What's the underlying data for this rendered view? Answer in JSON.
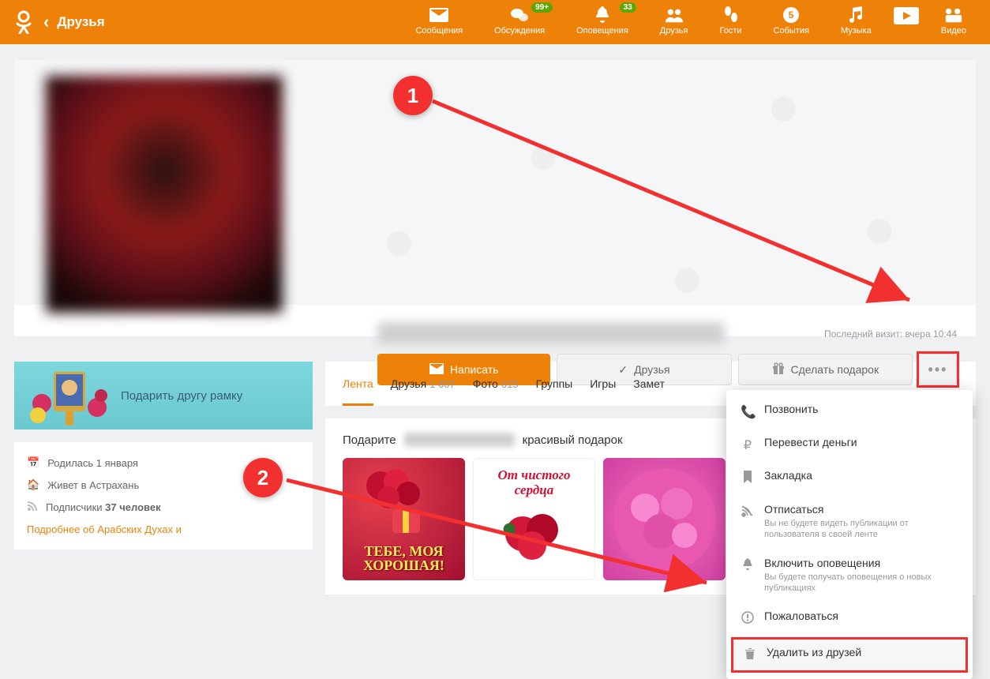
{
  "header": {
    "page_title": "Друзья",
    "nav": [
      {
        "label": "Сообщения"
      },
      {
        "label": "Обсуждения",
        "badge": "99+"
      },
      {
        "label": "Оповещения",
        "badge": "33"
      },
      {
        "label": "Друзья"
      },
      {
        "label": "Гости"
      },
      {
        "label": "События",
        "badge": "5"
      },
      {
        "label": "Музыка"
      },
      {
        "label": "Видео"
      }
    ]
  },
  "profile": {
    "last_visit": "Последний визит: вчера 10:44",
    "actions": {
      "write": "Написать",
      "friends": "Друзья",
      "gift": "Сделать подарок",
      "more": "•••"
    }
  },
  "sidebar": {
    "promo_text": "Подарить другу рамку",
    "info": {
      "born": "Родилась 1 января",
      "lives": "Живет в Астрахань",
      "subs_label": "Подписчики",
      "subs_count": "37 человек",
      "more": "Подробнее об Арабских Духах и"
    }
  },
  "tabs": [
    {
      "label": "Лента",
      "active": true
    },
    {
      "label": "Друзья",
      "count": "1 607"
    },
    {
      "label": "Фото",
      "count": "615"
    },
    {
      "label": "Группы"
    },
    {
      "label": "Игры"
    },
    {
      "label": "Замет"
    }
  ],
  "gift": {
    "title_prefix": "Подарите",
    "title_suffix": "красивый подарок",
    "items": [
      "ТЕБЕ, МОЯ ХОРОШАЯ!",
      "От чистого сердца",
      ""
    ]
  },
  "dropdown": [
    {
      "label": "Позвонить"
    },
    {
      "label": "Перевести деньги"
    },
    {
      "label": "Закладка"
    },
    {
      "label": "Отписаться",
      "sub": "Вы не будете видеть публикации от пользователя в своей ленте"
    },
    {
      "label": "Включить оповещения",
      "sub": "Вы будете получать оповещения о новых публикациях"
    },
    {
      "label": "Пожаловаться"
    },
    {
      "label": "Удалить из друзей"
    }
  ],
  "annot": {
    "one": "1",
    "two": "2"
  }
}
